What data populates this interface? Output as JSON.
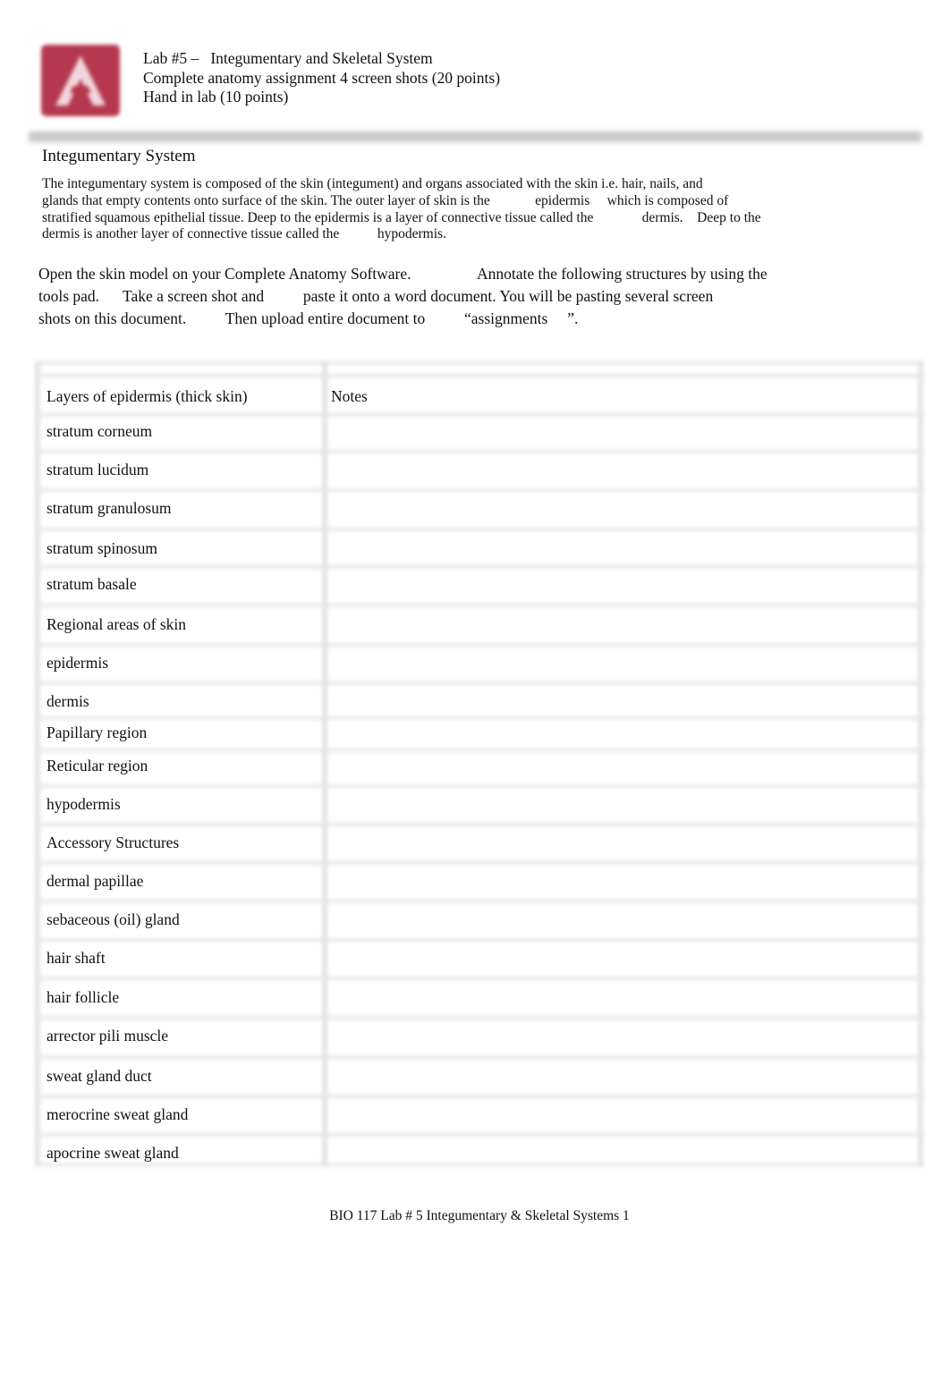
{
  "header": {
    "logo_letter": "A",
    "logo_color": "#b5384f",
    "lines": [
      "Lab #5 –   Integumentary and Skeletal System",
      "Complete anatomy assignment 4 screen shots (20 points)",
      "Hand in lab (10 points)"
    ]
  },
  "section_title": "Integumentary System",
  "intro_lines": [
    "The integumentary system is composed of the skin (integument) and organs associated with the skin i.e. hair, nails, and",
    "glands that empty contents onto surface of the skin. The outer layer of skin is the             epidermis     which is composed of",
    "stratified squamous epithelial tissue. Deep to the epidermis is a layer of connective tissue called the              dermis.    Deep to the",
    "dermis is another layer of connective tissue called the           hypodermis."
  ],
  "instruction_lines": [
    "Open the skin model on your Complete Anatomy Software.                 Annotate the following structures by using the",
    "tools pad.      Take a screen shot and          paste it onto a word document. You will be pasting several screen",
    "shots on this document.          Then upload entire document to          “assignments     ”."
  ],
  "table": {
    "headers": [
      "Layers of epidermis (thick skin)",
      "Notes"
    ],
    "rows": [
      "stratum corneum",
      "stratum lucidum",
      "stratum granulosum",
      "stratum spinosum",
      "stratum basale",
      "Regional areas of skin",
      "epidermis",
      "dermis",
      "Papillary region",
      "Reticular region",
      "hypodermis",
      "Accessory Structures",
      "dermal papillae",
      "sebaceous (oil) gland",
      "hair shaft",
      "hair follicle",
      "arrector pili muscle",
      "sweat gland duct",
      "merocrine sweat gland",
      "apocrine sweat gland"
    ]
  },
  "footer": "BIO 117 Lab # 5 Integumentary & Skeletal Systems 1"
}
